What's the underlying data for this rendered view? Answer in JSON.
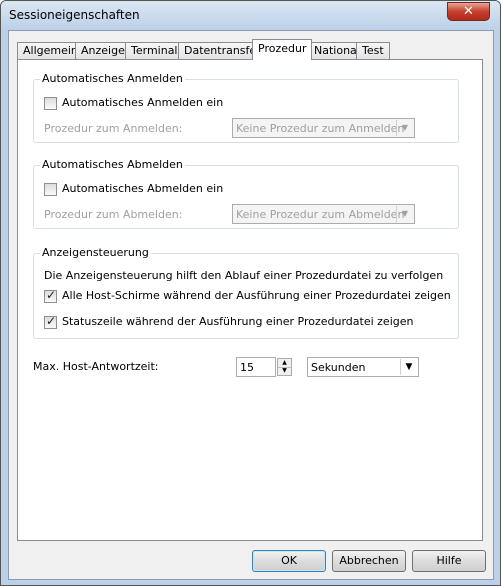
{
  "window": {
    "title": "Sessioneigenschaften"
  },
  "tabs": [
    "Allgemein",
    "Anzeige",
    "Terminal",
    "Datentransfer",
    "Prozedur",
    "National",
    "Test"
  ],
  "active_tab": "Prozedur",
  "auto_login": {
    "legend": "Automatisches Anmelden",
    "checkbox_label": "Automatisches Anmelden ein",
    "checked": false,
    "proc_label": "Prozedur zum Anmelden:",
    "proc_value": "Keine Prozedur zum Anmelden"
  },
  "auto_logout": {
    "legend": "Automatisches Abmelden",
    "checkbox_label": "Automatisches Abmelden ein",
    "checked": false,
    "proc_label": "Prozedur zum Abmelden:",
    "proc_value": "Keine Prozedur zum Abmelden"
  },
  "display_control": {
    "legend": "Anzeigensteuerung",
    "description": "Die Anzeigensteuerung hilft den Ablauf einer Prozedurdatei zu verfolgen",
    "option1_label": "Alle Host-Schirme während der Ausführung einer Prozedurdatei zeigen",
    "option1_checked": true,
    "option2_label": "Statuszeile während der Ausführung einer Prozedurdatei zeigen",
    "option2_checked": true
  },
  "host_response": {
    "label": "Max. Host-Antwortzeit:",
    "value": "15",
    "unit": "Sekunden"
  },
  "buttons": {
    "ok": "OK",
    "cancel": "Abbrechen",
    "help": "Hilfe"
  },
  "icons": {
    "close": "close-icon",
    "dropdown": "chevron-down-icon",
    "check": "check-icon"
  }
}
